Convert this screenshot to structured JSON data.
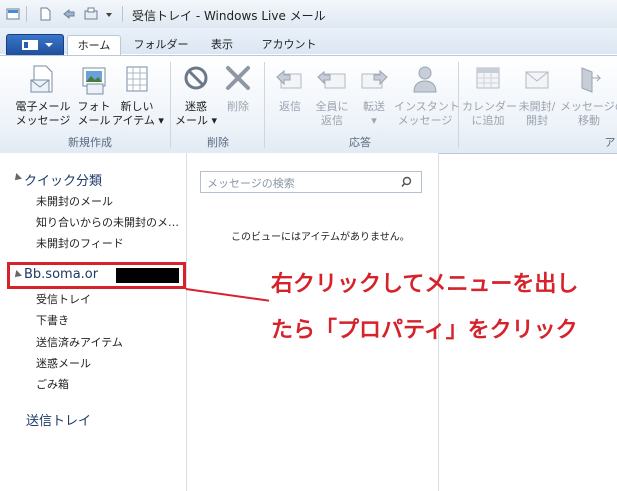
{
  "window": {
    "title": "受信トレイ - Windows Live メール"
  },
  "tabs": [
    {
      "label": "ホーム",
      "active": true
    },
    {
      "label": "フォルダー",
      "active": false
    },
    {
      "label": "表示",
      "active": false
    },
    {
      "label": "アカウント",
      "active": false
    }
  ],
  "ribbon": {
    "new": {
      "group_label": "新規作成",
      "email": {
        "line1": "電子メール",
        "line2": "メッセージ"
      },
      "photo": {
        "line1": "フォト",
        "line2": "メール"
      },
      "new_item": {
        "line1": "新しい",
        "line2": "アイテム ▾"
      }
    },
    "delete": {
      "group_label": "削除",
      "junk": {
        "line1": "迷惑",
        "line2": "メール ▾"
      },
      "delete": {
        "line1": "削除"
      }
    },
    "respond": {
      "group_label": "応答",
      "reply": {
        "line1": "返信"
      },
      "reply_all": {
        "line1": "全員に",
        "line2": "返信"
      },
      "forward": {
        "line1": "転送",
        "line2": "▾"
      },
      "instant": {
        "line1": "インスタント",
        "line2": "メッセージ"
      }
    },
    "actions": {
      "group_label": "ア",
      "calendar": {
        "line1": "カレンダー",
        "line2": "に追加"
      },
      "unread": {
        "line1": "未開封/",
        "line2": "開封"
      },
      "move": {
        "line1": "メッセージの",
        "line2": "移動"
      }
    }
  },
  "nav": {
    "quick_views": {
      "header": "クイック分類",
      "items": [
        "未開封のメール",
        "知り合いからの未開封のメ…",
        "未開封のフィード"
      ]
    },
    "account": {
      "name": "Bb.soma.or",
      "items": [
        "受信トレイ",
        "下書き",
        "送信済みアイテム",
        "迷惑メール",
        "ごみ箱"
      ]
    },
    "outbox": "送信トレイ"
  },
  "message_list": {
    "search_placeholder": "メッセージの検索",
    "empty_text": "このビューにはアイテムがありません。"
  },
  "annotation": {
    "line1": "右クリックしてメニューを出し",
    "line2": "たら「プロパティ」をクリック",
    "color": "#d6222a"
  },
  "colors": {
    "accent": "#1f4f9d",
    "annotation_red": "#d6222a"
  }
}
